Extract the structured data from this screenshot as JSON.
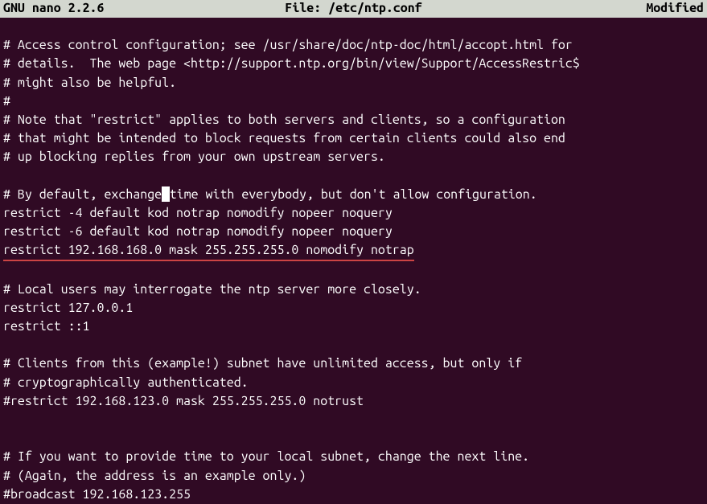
{
  "titlebar": {
    "app": "  GNU nano 2.2.6",
    "file_label": "File: /etc/ntp.conf",
    "status": "Modified"
  },
  "editor": {
    "lines": [
      "",
      "# Access control configuration; see /usr/share/doc/ntp-doc/html/accopt.html for",
      "# details.  The web page <http://support.ntp.org/bin/view/Support/AccessRestric$",
      "# might also be helpful.",
      "#",
      "# Note that \"restrict\" applies to both servers and clients, so a configuration",
      "# that might be intended to block requests from certain clients could also end",
      "# up blocking replies from your own upstream servers.",
      "",
      {
        "cursor_line": true,
        "before": "# By default, exchange",
        "after": "time with everybody, but don't allow configuration."
      },
      "restrict -4 default kod notrap nomodify nopeer noquery",
      "restrict -6 default kod notrap nomodify nopeer noquery",
      {
        "underlined": true,
        "text": "restrict 192.168.168.0 mask 255.255.255.0 nomodify notrap"
      },
      "",
      "# Local users may interrogate the ntp server more closely.",
      "restrict 127.0.0.1",
      "restrict ::1",
      "",
      "# Clients from this (example!) subnet have unlimited access, but only if",
      "# cryptographically authenticated.",
      "#restrict 192.168.123.0 mask 255.255.255.0 notrust",
      "",
      "",
      "# If you want to provide time to your local subnet, change the next line.",
      "# (Again, the address is an example only.)",
      "#broadcast 192.168.123.255"
    ]
  }
}
